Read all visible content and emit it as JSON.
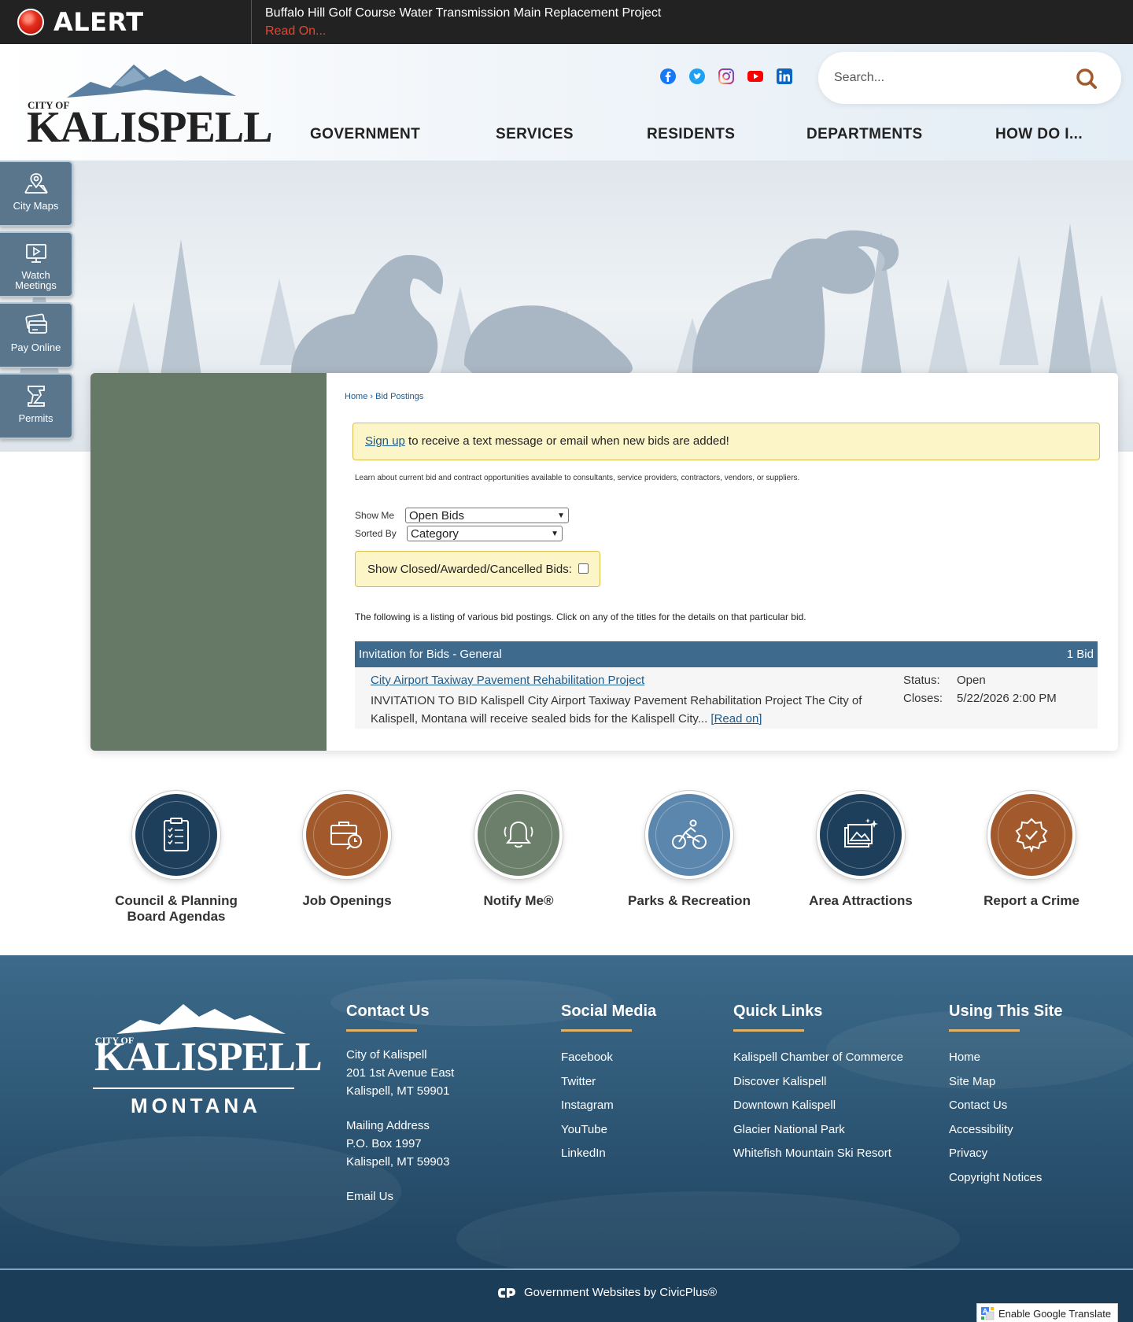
{
  "alert": {
    "label": "ALERT",
    "title": "Buffalo Hill Golf Course Water Transmission Main Replacement Project",
    "read_on": "Read On..."
  },
  "header": {
    "logo_city": "CITY OF",
    "logo_name": "KALISPELL",
    "search_placeholder": "Search...",
    "social_icons": [
      "facebook-icon",
      "twitter-icon",
      "instagram-icon",
      "youtube-icon",
      "linkedin-icon"
    ],
    "nav": [
      "GOVERNMENT",
      "SERVICES",
      "RESIDENTS",
      "DEPARTMENTS",
      "HOW DO I..."
    ]
  },
  "side_links": [
    {
      "label": "City Maps",
      "icon": "map-pin-icon"
    },
    {
      "label": "Watch Meetings",
      "icon": "video-icon"
    },
    {
      "label": "Pay Online",
      "icon": "credit-card-icon"
    },
    {
      "label": "Permits",
      "icon": "permit-icon"
    }
  ],
  "content": {
    "breadcrumb": {
      "home": "Home",
      "sep": "›",
      "current": "Bid Postings"
    },
    "notice": {
      "link": "Sign up",
      "text": " to receive a text message or email when new bids are added!"
    },
    "intro": "Learn about current bid and contract opportunities available to consultants, service providers, contractors, vendors, or suppliers.",
    "show_me": {
      "label": "Show Me",
      "value": "Open Bids"
    },
    "sorted_by": {
      "label": "Sorted By",
      "value": "Category"
    },
    "closed_label": "Show Closed/Awarded/Cancelled Bids:",
    "listing_note": "The following is a listing of various bid postings. Click on any of the titles for the details on that particular bid.",
    "category": {
      "title": "Invitation for Bids - General",
      "count": "1 Bid"
    },
    "bid": {
      "title": "City Airport Taxiway Pavement Rehabilitation Project",
      "desc": "INVITATION TO BID Kalispell City Airport Taxiway Pavement Rehabilitation Project The City of Kalispell, Montana will receive sealed bids for the Kalispell City... ",
      "read_on": "[Read on]",
      "status_label": "Status:",
      "status_value": "Open",
      "closes_label": "Closes:",
      "closes_value": "5/22/2026 2:00 PM"
    }
  },
  "quick_links": [
    {
      "label": "Council & Planning Board Agendas",
      "icon": "clipboard-icon",
      "color": "#1d3f5c"
    },
    {
      "label": "Job Openings",
      "icon": "briefcase-icon",
      "color": "#a25a2c"
    },
    {
      "label": "Notify Me®",
      "icon": "bell-icon",
      "color": "#6b7f6b"
    },
    {
      "label": "Parks & Recreation",
      "icon": "bicycle-icon",
      "color": "#5b86ad"
    },
    {
      "label": "Area Attractions",
      "icon": "gallery-icon",
      "color": "#1d3f5c"
    },
    {
      "label": "Report a Crime",
      "icon": "badge-icon",
      "color": "#a25a2c"
    }
  ],
  "footer": {
    "logo_city": "CITY OF",
    "logo_name": "KALISPELL",
    "logo_state": "MONTANA",
    "contact": {
      "heading": "Contact Us",
      "lines1": [
        "City of Kalispell",
        "201 1st Avenue East",
        "Kalispell, MT 59901"
      ],
      "lines2": [
        "Mailing Address",
        "P.O. Box 1997",
        "Kalispell, MT 59903"
      ],
      "email": "Email Us"
    },
    "social": {
      "heading": "Social Media",
      "links": [
        "Facebook",
        "Twitter",
        "Instagram",
        "YouTube",
        "LinkedIn"
      ]
    },
    "quick": {
      "heading": "Quick Links",
      "links": [
        "Kalispell Chamber of Commerce",
        "Discover Kalispell",
        "Downtown Kalispell",
        "Glacier National Park",
        "Whitefish Mountain Ski Resort"
      ]
    },
    "using": {
      "heading": "Using This Site",
      "links": [
        "Home",
        "Site Map",
        "Contact Us",
        "Accessibility",
        "Privacy",
        "Copyright Notices"
      ]
    },
    "accent_color": "#e1b36a"
  },
  "bottom": {
    "civicplus": "Government Websites by CivicPlus®",
    "translate": "Enable Google Translate"
  }
}
